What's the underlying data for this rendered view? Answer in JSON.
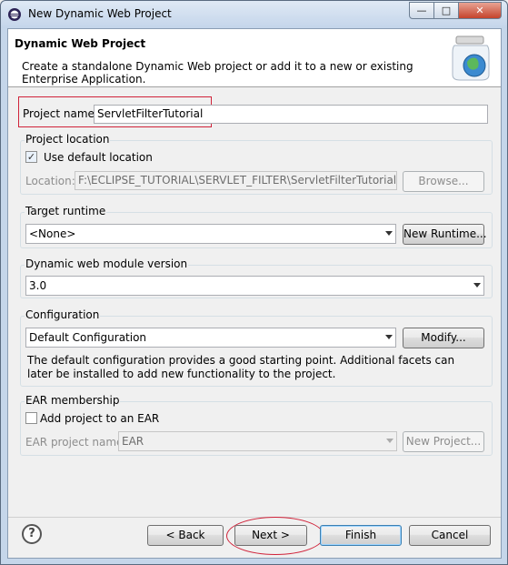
{
  "window": {
    "title": "New Dynamic Web Project",
    "minimize_glyph": "—",
    "maximize_glyph": "□",
    "close_glyph": "✕"
  },
  "header": {
    "title": "Dynamic Web Project",
    "description": "Create a standalone Dynamic Web project or add it to a new or existing Enterprise Application.",
    "icon": "web-project-jar-icon"
  },
  "project_name": {
    "label": "Project name:",
    "value": "ServletFilterTutorial"
  },
  "project_location": {
    "group_title": "Project location",
    "use_default_label": "Use default location",
    "use_default_checked": true,
    "location_label": "Location:",
    "location_value": "F:\\ECLIPSE_TUTORIAL\\SERVLET_FILTER\\ServletFilterTutorial",
    "browse_label": "Browse..."
  },
  "target_runtime": {
    "group_title": "Target runtime",
    "selected": "<None>",
    "new_runtime_label": "New Runtime..."
  },
  "module_version": {
    "group_title": "Dynamic web module version",
    "selected": "3.0"
  },
  "configuration": {
    "group_title": "Configuration",
    "selected": "Default Configuration",
    "modify_label": "Modify...",
    "description": "The default configuration provides a good starting point. Additional facets can later be installed to add new functionality to the project."
  },
  "ear_membership": {
    "group_title": "EAR membership",
    "add_label": "Add project to an EAR",
    "add_checked": false,
    "ear_name_label": "EAR project name:",
    "ear_name_value": "EAR",
    "new_project_label": "New Project..."
  },
  "footer": {
    "help_glyph": "?",
    "back_label": "< Back",
    "next_label": "Next >",
    "finish_label": "Finish",
    "cancel_label": "Cancel"
  },
  "colors": {
    "annotation_red": "#d0233a",
    "window_frame": "#c5d6ea"
  }
}
